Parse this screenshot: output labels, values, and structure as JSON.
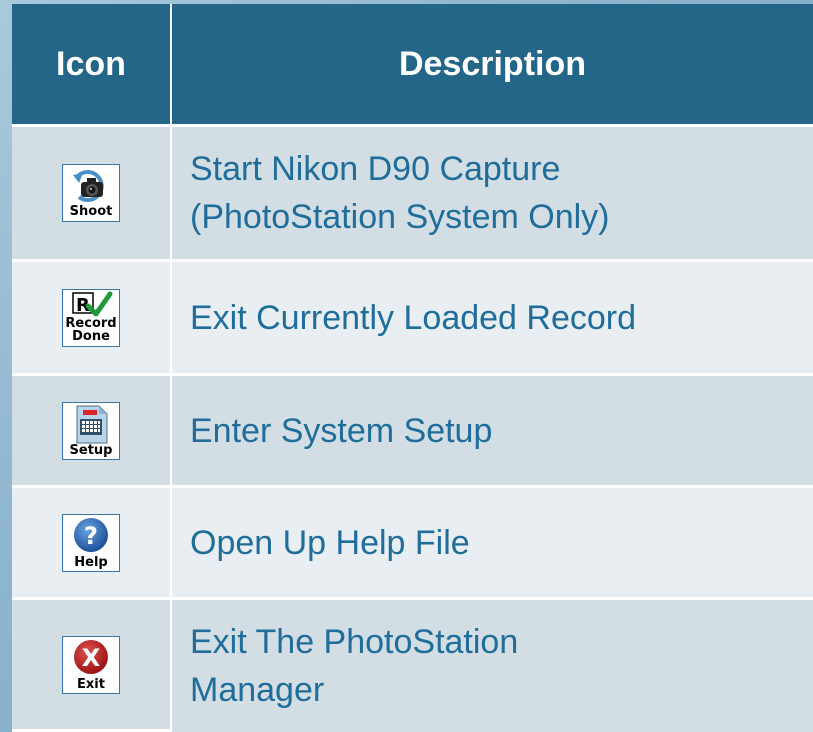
{
  "header": {
    "icon_col": "Icon",
    "desc_col": "Description"
  },
  "rows": [
    {
      "icon": "shoot-camera-icon",
      "icon_label": "Shoot",
      "description": "Start Nikon D90 Capture\n(PhotoStation System Only)"
    },
    {
      "icon": "record-done-icon",
      "icon_label_line1": "Record",
      "icon_label_line2": "Done",
      "icon_badge": "R",
      "description": "Exit Currently Loaded Record"
    },
    {
      "icon": "setup-icon",
      "icon_label": "Setup",
      "description": "Enter System Setup"
    },
    {
      "icon": "help-icon",
      "icon_label": "Help",
      "icon_badge": "?",
      "description": "Open Up Help File"
    },
    {
      "icon": "exit-icon",
      "icon_label": "Exit",
      "icon_badge": "X",
      "description": "Exit The PhotoStation\nManager"
    }
  ],
  "colors": {
    "header_bg": "#236688",
    "row_dark": "#d3dde4",
    "row_light": "#e9eef2",
    "desc_text": "#1f6d9a",
    "background": "#8fb6cf"
  }
}
